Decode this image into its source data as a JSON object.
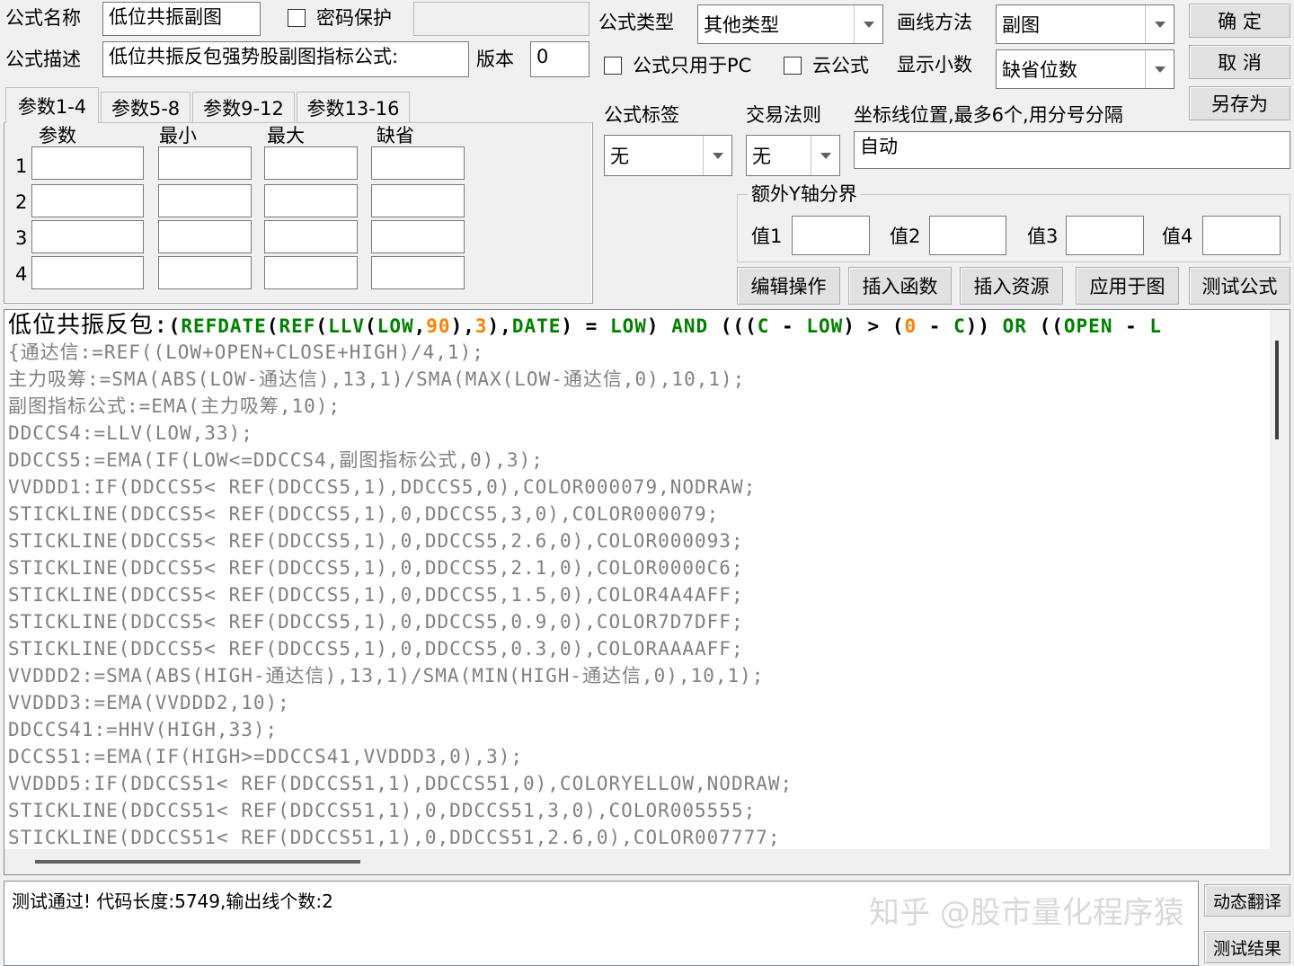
{
  "header": {
    "name_label": "公式名称",
    "name_value": "低位共振副图",
    "password_label": "密码保护",
    "desc_label": "公式描述",
    "desc_value": "低位共振反包强势股副图指标公式:",
    "version_label": "版本",
    "version_value": "0"
  },
  "props": {
    "type_label": "公式类型",
    "type_value": "其他类型",
    "draw_label": "画线方法",
    "draw_value": "副图",
    "pc_only_label": "公式只用于PC",
    "cloud_label": "云公式",
    "decimals_label": "显示小数",
    "decimals_value": "缺省位数",
    "tag_label": "公式标签",
    "tag_value": "无",
    "trade_label": "交易法则",
    "trade_value": "无",
    "axis_label": "坐标线位置,最多6个,用分号分隔",
    "axis_value": "自动"
  },
  "actions": {
    "ok": "确  定",
    "cancel": "取  消",
    "save_as": "另存为"
  },
  "tabs": [
    "参数1-4",
    "参数5-8",
    "参数9-12",
    "参数13-16"
  ],
  "params": {
    "col_param": "参数",
    "col_min": "最小",
    "col_max": "最大",
    "col_default": "缺省",
    "rows": [
      "1",
      "2",
      "3",
      "4"
    ]
  },
  "yaxis": {
    "title": "额外Y轴分界",
    "v1": "值1",
    "v2": "值2",
    "v3": "值3",
    "v4": "值4"
  },
  "toolbar": {
    "edit": "编辑操作",
    "insert_func": "插入函数",
    "insert_res": "插入资源",
    "apply": "应用于图",
    "test": "测试公式"
  },
  "code": {
    "line1_prefix": "低位共振反包:",
    "lines": [
      "{通达信:=REF((LOW+OPEN+CLOSE+HIGH)/4,1);",
      "主力吸筹:=SMA(ABS(LOW-通达信),13,1)/SMA(MAX(LOW-通达信,0),10,1);",
      "副图指标公式:=EMA(主力吸筹,10);",
      "DDCCS4:=LLV(LOW,33);",
      "DDCCS5:=EMA(IF(LOW<=DDCCS4,副图指标公式,0),3);",
      "VVDDD1:IF(DDCCS5< REF(DDCCS5,1),DDCCS5,0),COLOR000079,NODRAW;",
      "STICKLINE(DDCCS5< REF(DDCCS5,1),0,DDCCS5,3,0),COLOR000079;",
      "STICKLINE(DDCCS5< REF(DDCCS5,1),0,DDCCS5,2.6,0),COLOR000093;",
      "STICKLINE(DDCCS5< REF(DDCCS5,1),0,DDCCS5,2.1,0),COLOR0000C6;",
      "STICKLINE(DDCCS5< REF(DDCCS5,1),0,DDCCS5,1.5,0),COLOR4A4AFF;",
      "STICKLINE(DDCCS5< REF(DDCCS5,1),0,DDCCS5,0.9,0),COLOR7D7DFF;",
      "STICKLINE(DDCCS5< REF(DDCCS5,1),0,DDCCS5,0.3,0),COLORAAAAFF;",
      "VVDDD2:=SMA(ABS(HIGH-通达信),13,1)/SMA(MIN(HIGH-通达信,0),10,1);",
      "VVDDD3:=EMA(VVDDD2,10);",
      "DDCCS41:=HHV(HIGH,33);",
      "DCCS51:=EMA(IF(HIGH>=DDCCS41,VVDDD3,0),3);",
      "VVDDD5:IF(DDCCS51< REF(DDCCS51,1),DDCCS51,0),COLORYELLOW,NODRAW;",
      "STICKLINE(DDCCS51< REF(DDCCS51,1),0,DDCCS51,3,0),COLOR005555;",
      "STICKLINE(DDCCS51< REF(DDCCS51,1),0,DDCCS51,2.6,0),COLOR007777;"
    ]
  },
  "status": {
    "message": "测试通过! 代码长度:5749,输出线个数:2",
    "translate_btn": "动态翻译",
    "results_btn": "测试结果",
    "watermark": "知乎 @股市量化程序猿"
  }
}
